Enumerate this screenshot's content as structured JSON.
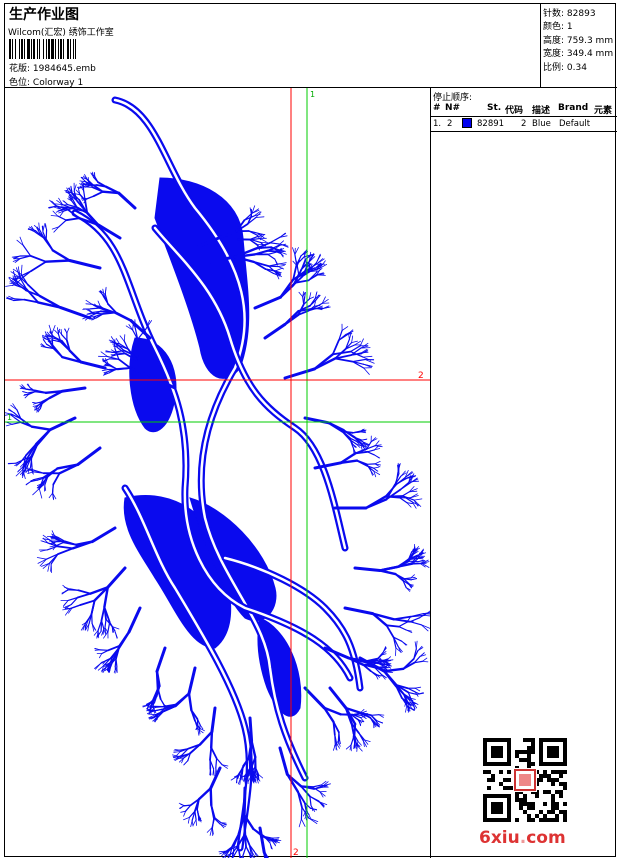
{
  "header": {
    "title": "生产作业图",
    "company": "Wilcom(汇宏) 绣饰工作室",
    "file_label": "花版:",
    "file_name": "1984645.emb",
    "colorway_label": "色位:",
    "colorway_name": "Colorway 1"
  },
  "stats": [
    {
      "label": "针数:",
      "value": "82893"
    },
    {
      "label": "颜色:",
      "value": "1"
    },
    {
      "label": "高度:",
      "value": "759.3 mm"
    },
    {
      "label": "宽度:",
      "value": "349.4 mm"
    },
    {
      "label": "比例:",
      "value": "0.34"
    }
  ],
  "guides": {
    "green_vertical_label": "1",
    "green_horizontal_label": "1",
    "red_horizontal_label": "2",
    "red_vertical_label": "2"
  },
  "stop_sequence": {
    "title": "停止顺序:",
    "headers": {
      "num": "#",
      "needle": "N#",
      "stitches": "St.",
      "code": "代码",
      "description": "描述",
      "brand": "Brand",
      "element": "元素"
    },
    "rows": [
      {
        "num": "1.",
        "needle": "2",
        "color": "#0000ee",
        "stitches": "82891",
        "code": "2",
        "description": "Blue",
        "brand": "Default",
        "element": ""
      }
    ]
  },
  "watermark": {
    "text_main": "6xiu",
    "text_dot": ".",
    "text_tail": "com"
  },
  "colors": {
    "thread": "#0a0aee",
    "guide_red": "#ff0000",
    "guide_green": "#00cc00"
  }
}
